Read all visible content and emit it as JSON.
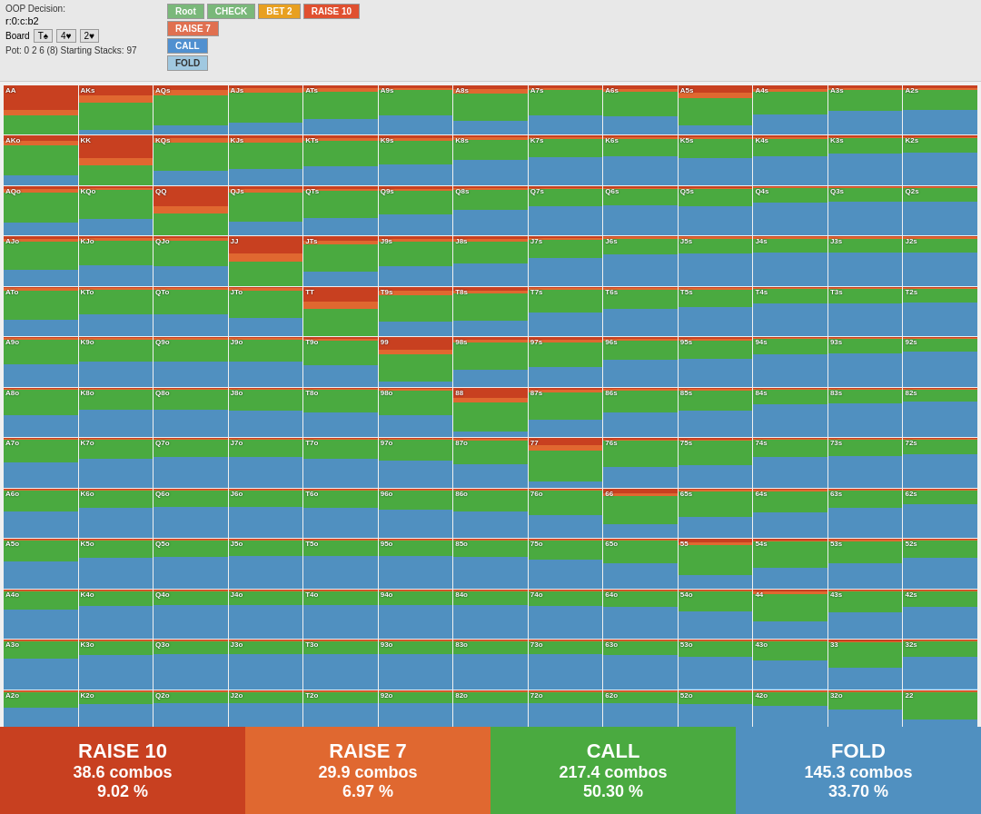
{
  "header": {
    "oop_label": "OOP Decision:",
    "hand": "r:0:c:b2",
    "board_label": "Board",
    "board_cards": [
      "T♠",
      "4♥",
      "2♥"
    ],
    "pot": "Pot: 0 2 6 (8) Starting Stacks: 97"
  },
  "nav_buttons": {
    "root": "Root",
    "check": "CHECK",
    "bet2": "BET 2",
    "raise10": "RAISE 10",
    "raise7": "RAISE 7",
    "call": "CALL",
    "fold": "FOLD"
  },
  "summary": [
    {
      "action": "RAISE 10",
      "combos": "38.6 combos",
      "pct": "9.02 %",
      "color_class": "summary-raise10"
    },
    {
      "action": "RAISE 7",
      "combos": "29.9 combos",
      "pct": "6.97 %",
      "color_class": "summary-raise7"
    },
    {
      "action": "CALL",
      "combos": "217.4 combos",
      "pct": "50.30 %",
      "color_class": "summary-call"
    },
    {
      "action": "FOLD",
      "combos": "145.3 combos",
      "pct": "33.70 %",
      "color_class": "summary-fold"
    }
  ],
  "matrix_labels": [
    [
      "AA",
      "AKs",
      "AQs",
      "AJs",
      "ATs",
      "A9s",
      "A8s",
      "A7s",
      "A6s",
      "A5s",
      "A4s",
      "A3s",
      "A2s"
    ],
    [
      "AKo",
      "KK",
      "KQs",
      "KJs",
      "KTs",
      "K9s",
      "K8s",
      "K7s",
      "K6s",
      "K5s",
      "K4s",
      "K3s",
      "K2s"
    ],
    [
      "AQo",
      "KQo",
      "QQ",
      "QJs",
      "QTs",
      "Q9s",
      "Q8s",
      "Q7s",
      "Q6s",
      "Q5s",
      "Q4s",
      "Q3s",
      "Q2s"
    ],
    [
      "AJo",
      "KJo",
      "QJo",
      "JJ",
      "JTs",
      "J9s",
      "J8s",
      "J7s",
      "J6s",
      "J5s",
      "J4s",
      "J3s",
      "J2s"
    ],
    [
      "ATo",
      "KTo",
      "QTo",
      "JTo",
      "TT",
      "T9s",
      "T8s",
      "T7s",
      "T6s",
      "T5s",
      "T4s",
      "T3s",
      "T2s"
    ],
    [
      "A9o",
      "K9o",
      "Q9o",
      "J9o",
      "T9o",
      "99",
      "98s",
      "97s",
      "96s",
      "95s",
      "94s",
      "93s",
      "92s"
    ],
    [
      "A8o",
      "K8o",
      "Q8o",
      "J8o",
      "T8o",
      "98o",
      "88",
      "87s",
      "86s",
      "85s",
      "84s",
      "83s",
      "82s"
    ],
    [
      "A7o",
      "K7o",
      "Q7o",
      "J7o",
      "T7o",
      "97o",
      "87o",
      "77",
      "76s",
      "75s",
      "74s",
      "73s",
      "72s"
    ],
    [
      "A6o",
      "K6o",
      "Q6o",
      "J6o",
      "T6o",
      "96o",
      "86o",
      "76o",
      "66",
      "65s",
      "64s",
      "63s",
      "62s"
    ],
    [
      "A5o",
      "K5o",
      "Q5o",
      "J5o",
      "T5o",
      "95o",
      "85o",
      "75o",
      "65o",
      "55",
      "54s",
      "53s",
      "52s"
    ],
    [
      "A4o",
      "K4o",
      "Q4o",
      "J4o",
      "T4o",
      "94o",
      "84o",
      "74o",
      "64o",
      "54o",
      "44",
      "43s",
      "42s"
    ],
    [
      "A3o",
      "K3o",
      "Q3o",
      "J3o",
      "T3o",
      "93o",
      "83o",
      "73o",
      "63o",
      "53o",
      "43o",
      "33",
      "32s"
    ],
    [
      "A2o",
      "K2o",
      "Q2o",
      "J2o",
      "T2o",
      "92o",
      "82o",
      "72o",
      "62o",
      "52o",
      "42o",
      "32o",
      "22"
    ]
  ]
}
